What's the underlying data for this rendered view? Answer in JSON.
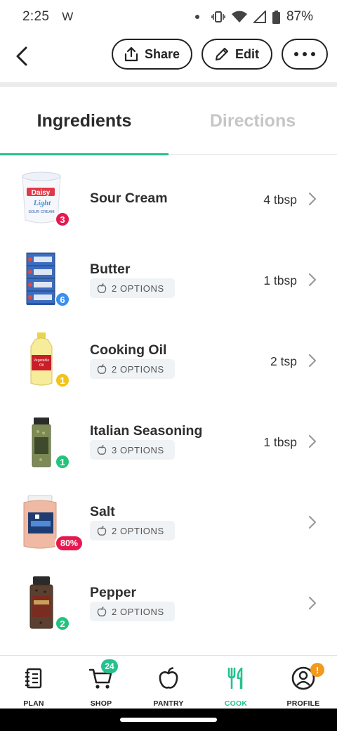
{
  "status_bar": {
    "time": "2:25",
    "carrier_glyph": "W",
    "battery": "87%"
  },
  "header": {
    "share_label": "Share",
    "edit_label": "Edit"
  },
  "tabs": [
    {
      "label": "Ingredients",
      "active": true
    },
    {
      "label": "Directions",
      "active": false
    }
  ],
  "ingredients": [
    {
      "name": "Sour Cream",
      "quantity": "4 tbsp",
      "badge": "3",
      "badge_color": "#e5194f",
      "options": ""
    },
    {
      "name": "Butter",
      "quantity": "1 tbsp",
      "badge": "6",
      "badge_color": "#3b8ff0",
      "options": "2 OPTIONS"
    },
    {
      "name": "Cooking Oil",
      "quantity": "2 tsp",
      "badge": "1",
      "badge_color": "#f1c41a",
      "options": "2 OPTIONS"
    },
    {
      "name": "Italian Seasoning",
      "quantity": "1 tbsp",
      "badge": "1",
      "badge_color": "#22c47e",
      "options": "3 OPTIONS"
    },
    {
      "name": "Salt",
      "quantity": "",
      "badge": "80%",
      "badge_color": "#e5194f",
      "options": "2 OPTIONS"
    },
    {
      "name": "Pepper",
      "quantity": "",
      "badge": "2",
      "badge_color": "#22c47e",
      "options": "2 OPTIONS"
    }
  ],
  "product_label_text": {
    "sour_cream_brand": "Daisy",
    "sour_cream_variant": "Light",
    "sour_cream_type": "SOUR CREAM",
    "oil_label": "Vegetable Oil"
  },
  "bottom_nav": [
    {
      "label": "PLAN",
      "icon": "notebook-icon"
    },
    {
      "label": "SHOP",
      "icon": "cart-icon",
      "badge": "24"
    },
    {
      "label": "PANTRY",
      "icon": "apple-icon"
    },
    {
      "label": "COOK",
      "icon": "utensils-icon",
      "active": true
    },
    {
      "label": "PROFILE",
      "icon": "profile-icon",
      "alert": "!"
    }
  ],
  "colors": {
    "accent": "#25c18f",
    "inactive_tab": "#c6c6c6",
    "alert": "#f39a1d"
  }
}
